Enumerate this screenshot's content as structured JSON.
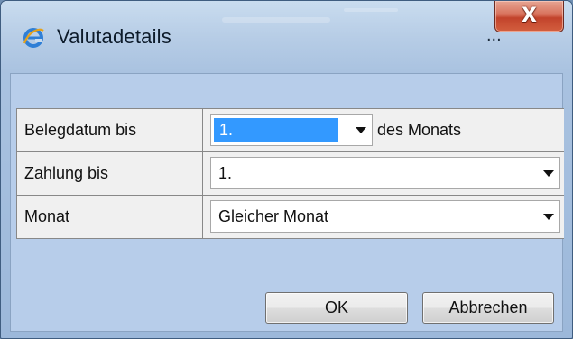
{
  "window": {
    "title": "Valutadetails",
    "title_ellipsis": "...",
    "close_glyph": "X"
  },
  "rows": [
    {
      "label": "Belegdatum bis",
      "value": "1.",
      "suffix": "des Monats",
      "value_selected": true
    },
    {
      "label": "Zahlung bis",
      "value": "1."
    },
    {
      "label": "Monat",
      "value": "Gleicher Monat"
    }
  ],
  "buttons": {
    "ok": "OK",
    "cancel": "Abbrechen"
  },
  "icons": {
    "app": "ie-logo-icon",
    "close": "close-icon",
    "dropdown": "chevron-down-icon"
  },
  "colors": {
    "selection": "#3399ff",
    "close_button": "#c9482f",
    "frame": "#b7cdea"
  }
}
